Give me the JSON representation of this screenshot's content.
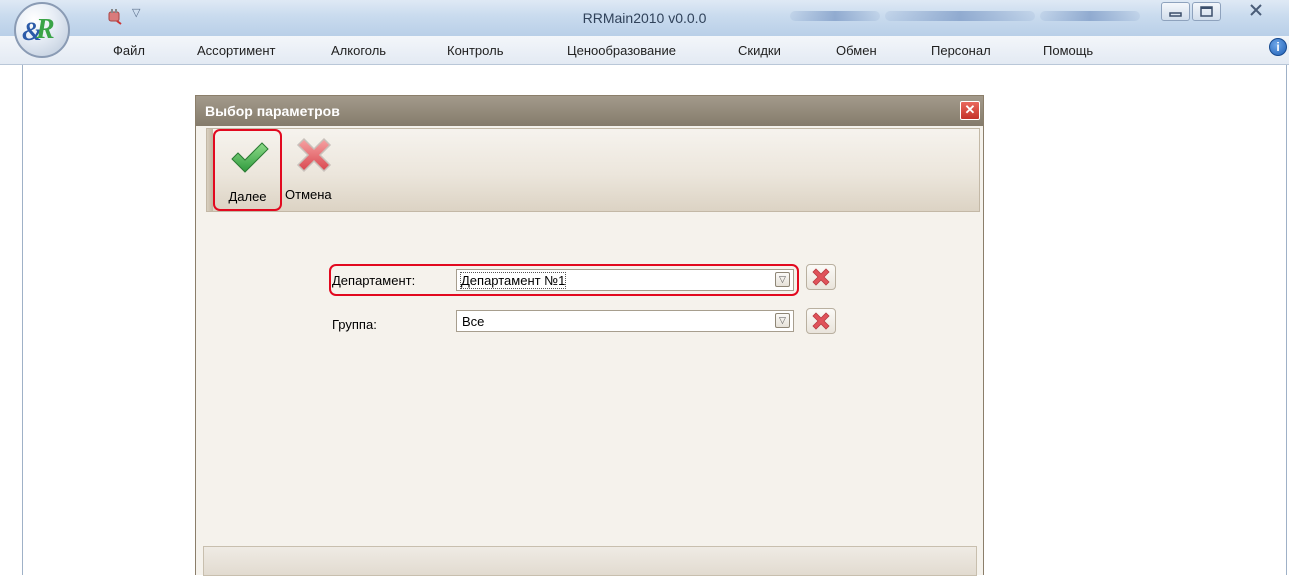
{
  "window": {
    "title": "RRMain2010 v0.0.0"
  },
  "menu": {
    "items": [
      "Файл",
      "Ассортимент",
      "Алкоголь",
      "Контроль",
      "Ценообразование",
      "Скидки",
      "Обмен",
      "Персонал",
      "Помощь"
    ]
  },
  "dialog": {
    "title": "Выбор параметров",
    "toolbar": {
      "next_label": "Далее",
      "cancel_label": "Отмена"
    },
    "fields": {
      "department": {
        "label": "Департамент:",
        "value": "Департамент №1"
      },
      "group": {
        "label": "Группа:",
        "value": "Все"
      }
    }
  },
  "icons": {
    "app": "rr-logo-icon",
    "quick_access": "plug-icon",
    "next": "checkmark-icon",
    "cancel": "red-x-icon",
    "clear": "clear-x-icon",
    "help": "help-icon"
  },
  "colors": {
    "highlight": "#e2091f",
    "dialog_title": "#857b6b",
    "accept_green": "#3aa447",
    "cancel_red": "#e0525a"
  }
}
